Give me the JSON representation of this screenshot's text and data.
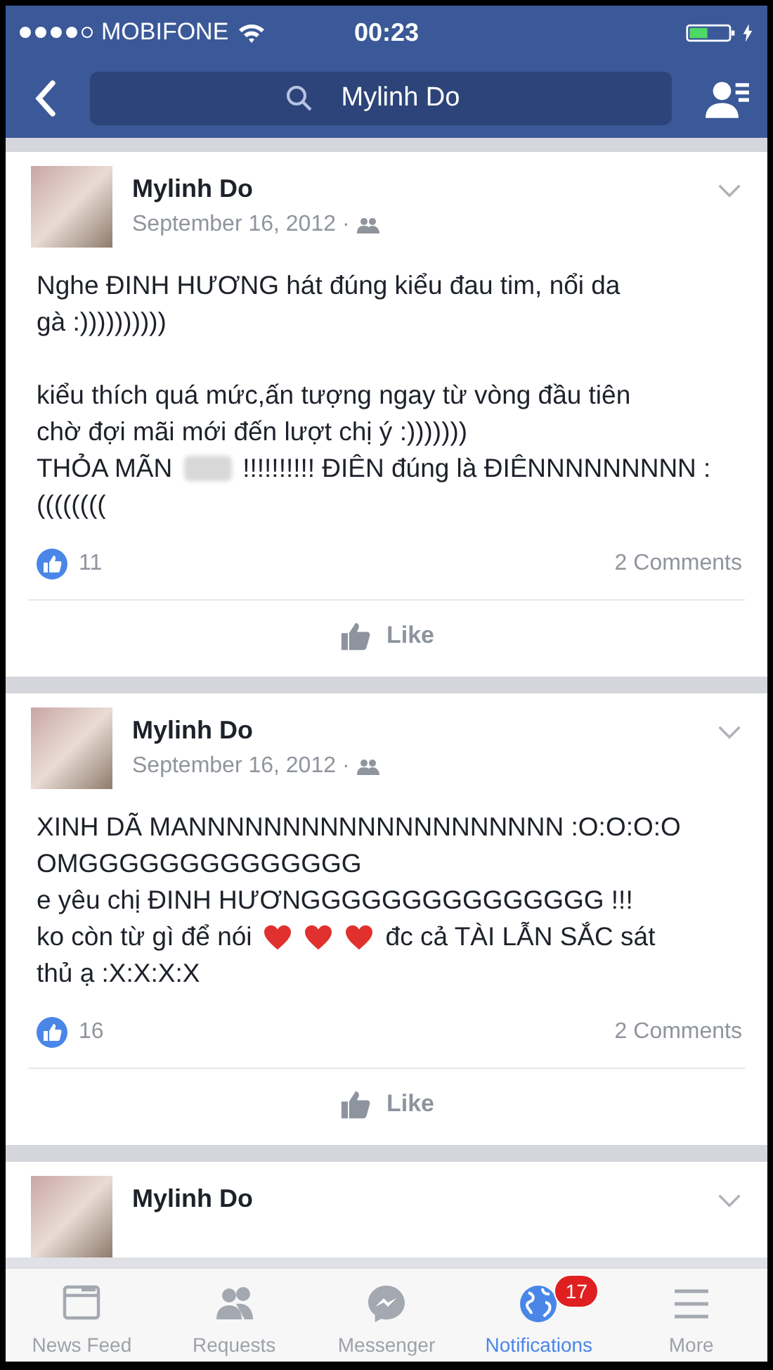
{
  "status_bar": {
    "carrier": "MOBIFONE",
    "time": "00:23",
    "signal_dots": [
      {
        "on": true
      },
      {
        "on": true
      },
      {
        "on": true
      },
      {
        "on": true
      },
      {
        "on": false
      }
    ]
  },
  "nav_bar": {
    "search": {
      "value": "Mylinh Do"
    }
  },
  "posts": [
    {
      "name": "Mylinh Do",
      "date": "September 16, 2012 ·",
      "lines": [
        {
          "kind": "text",
          "parts": [
            {
              "kind": "text",
              "text": "Nghe ĐINH HƯƠNG hát đúng kiểu đau tim, nổi da"
            }
          ]
        },
        {
          "kind": "text",
          "parts": [
            {
              "kind": "text",
              "text": "gà  :))))))))))"
            }
          ]
        },
        {
          "kind": "blank"
        },
        {
          "kind": "text",
          "parts": [
            {
              "kind": "text",
              "text": "kiểu thích quá mức,ấn tượng ngay từ vòng đầu tiên"
            }
          ]
        },
        {
          "kind": "text",
          "parts": [
            {
              "kind": "text",
              "text": "chờ đợi mãi mới đến lượt chị ý :)))))))"
            }
          ]
        },
        {
          "kind": "text",
          "parts": [
            {
              "kind": "text",
              "text": "THỎA MÃN"
            },
            {
              "kind": "blur"
            },
            {
              "kind": "text",
              "text": "!!!!!!!!!! ĐIÊN đúng là ĐIÊNNNNNNNNN :"
            }
          ]
        },
        {
          "kind": "text",
          "parts": [
            {
              "kind": "text",
              "text": "(((((((("
            }
          ]
        }
      ],
      "likes": "11",
      "comments": "2 Comments",
      "like_label": "Like"
    },
    {
      "name": "Mylinh Do",
      "date": "September 16, 2012 ·",
      "lines": [
        {
          "kind": "text",
          "parts": [
            {
              "kind": "text",
              "text": "XINH DÃ MANNNNNNNNNNNNNNNNNNNN :O:O:O:O"
            }
          ]
        },
        {
          "kind": "text",
          "parts": [
            {
              "kind": "text",
              "text": "OMGGGGGGGGGGGGGG"
            }
          ]
        },
        {
          "kind": "text",
          "parts": [
            {
              "kind": "text",
              "text": "e yêu chị ĐINH HƯƠNGGGGGGGGGGGGGGG !!!"
            }
          ]
        },
        {
          "kind": "text",
          "parts": [
            {
              "kind": "text",
              "text": "ko còn từ gì để nói"
            },
            {
              "kind": "heart"
            },
            {
              "kind": "heart"
            },
            {
              "kind": "heart"
            },
            {
              "kind": "text",
              "text": "đc cả TÀI LẪN SẮC sát"
            }
          ]
        },
        {
          "kind": "text",
          "parts": [
            {
              "kind": "text",
              "text": "thủ ạ :X:X:X:X"
            }
          ]
        }
      ],
      "likes": "16",
      "comments": "2 Comments",
      "like_label": "Like"
    },
    {
      "name": "Mylinh Do"
    }
  ],
  "tab_bar": [
    {
      "label": "News Feed",
      "kind": "feed",
      "selected": false
    },
    {
      "label": "Requests",
      "kind": "people",
      "selected": false
    },
    {
      "label": "Messenger",
      "kind": "messenger",
      "selected": false
    },
    {
      "label": "Notifications",
      "kind": "globe",
      "selected": true,
      "badge": "17"
    },
    {
      "label": "More",
      "kind": "menu",
      "selected": false
    }
  ]
}
